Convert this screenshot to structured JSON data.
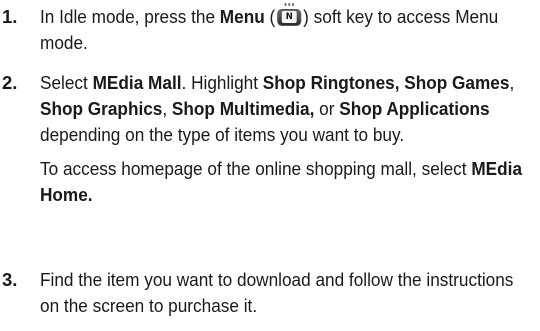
{
  "steps": [
    {
      "number": "1.",
      "parts": {
        "p1": "In Idle mode, press the ",
        "p2": "Menu",
        "p3": " (",
        "p4": ") soft key to access Menu mode."
      },
      "icon": {
        "name": "menu-soft-key-icon",
        "glyph": "N"
      }
    },
    {
      "number": "2.",
      "parts": {
        "p1": "Select ",
        "p2": "MEdia Mall",
        "p3": ". Highlight ",
        "p4": "Shop Ringtones, Shop Games",
        "p5": ", ",
        "p6": "Shop Graphics",
        "p7": ", ",
        "p8": "Shop Multimedia,",
        "p9": " or ",
        "p10": "Shop Applications",
        "p11": " depending on the type of items you want to buy."
      },
      "note": {
        "n1": "To access homepage of the online shopping mall, select ",
        "n2": "MEdia Home."
      }
    },
    {
      "number": "3.",
      "text": "Find the item you want to download and follow the instructions on the screen to purchase it."
    }
  ]
}
